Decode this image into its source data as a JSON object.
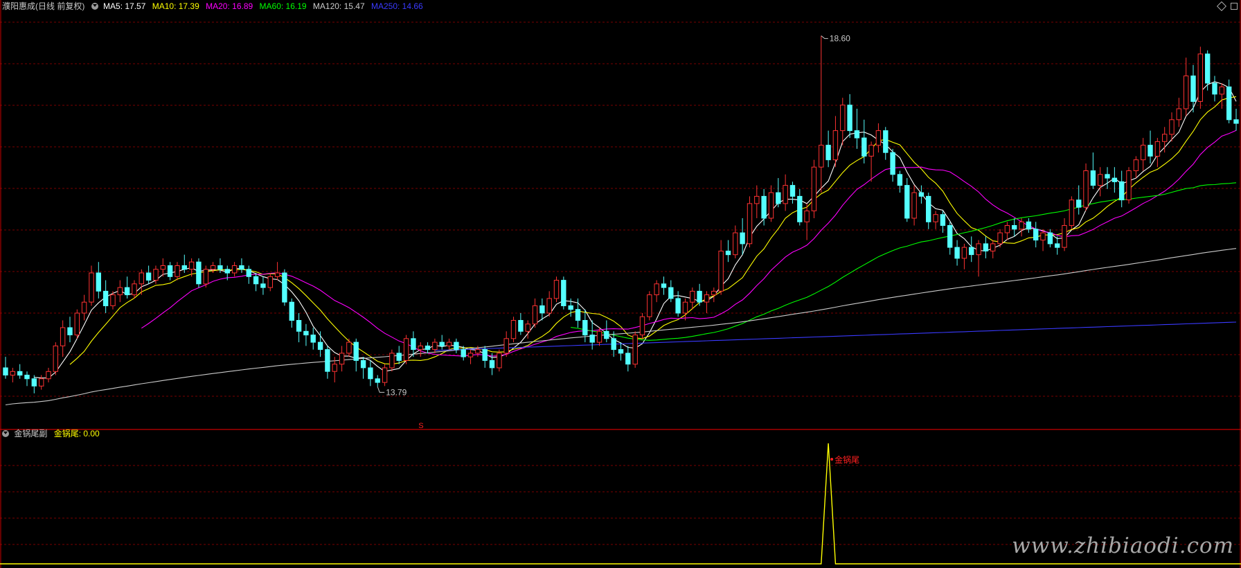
{
  "header": {
    "title": "濮阳惠成(日线 前复权)",
    "ma": [
      {
        "label": "MA5: 17.57",
        "color": "#ffffff"
      },
      {
        "label": "MA10: 17.39",
        "color": "#ffff00"
      },
      {
        "label": "MA20: 16.89",
        "color": "#ff00ff"
      },
      {
        "label": "MA60: 16.19",
        "color": "#00ff00"
      },
      {
        "label": "MA120: 15.47",
        "color": "#cccccc"
      },
      {
        "label": "MA250: 14.66",
        "color": "#3a3aff"
      }
    ]
  },
  "sub_header": {
    "indicator": "金锅尾副",
    "value_label": "金锅尾: 0.00"
  },
  "watermark": "www.zhibiaodi.com",
  "colors": {
    "up": "#ff3232",
    "down": "#54ffff",
    "grid": "#7a0000",
    "separator": "#c80000",
    "ma5": "#ffffff",
    "ma10": "#ffff00",
    "ma20": "#ff00ff",
    "ma60": "#00ff00",
    "ma120": "#cccccc",
    "ma250": "#3a3aff",
    "indicator": "#ffff00",
    "signal": "#ff2020"
  },
  "chart_data": [
    {
      "type": "candlestick",
      "title": "濮阳惠成(日线 前复权)",
      "ylim": [
        13.3,
        18.9
      ],
      "annotations": [
        {
          "text": "18.60",
          "kind": "period-high",
          "value": 18.6,
          "bar": 114
        },
        {
          "text": "13.79",
          "kind": "period-low",
          "value": 13.79,
          "bar": 52
        },
        {
          "text": "S",
          "kind": "signal",
          "bar": 58
        }
      ],
      "ohlc": [
        [
          14.05,
          14.2,
          13.9,
          13.95
        ],
        [
          13.95,
          14.05,
          13.85,
          14.0
        ],
        [
          14.0,
          14.1,
          13.9,
          13.95
        ],
        [
          13.95,
          14.0,
          13.8,
          13.9
        ],
        [
          13.9,
          13.95,
          13.7,
          13.8
        ],
        [
          13.8,
          13.95,
          13.75,
          13.9
        ],
        [
          13.9,
          14.05,
          13.85,
          14.0
        ],
        [
          14.0,
          14.4,
          13.95,
          14.35
        ],
        [
          14.35,
          14.7,
          14.2,
          14.6
        ],
        [
          14.6,
          14.75,
          14.4,
          14.5
        ],
        [
          14.5,
          14.85,
          14.45,
          14.8
        ],
        [
          14.8,
          15.05,
          14.7,
          14.95
        ],
        [
          14.95,
          15.45,
          14.9,
          15.35
        ],
        [
          15.35,
          15.5,
          15.0,
          15.1
        ],
        [
          15.1,
          15.25,
          14.8,
          14.9
        ],
        [
          14.9,
          15.1,
          14.85,
          15.05
        ],
        [
          15.05,
          15.25,
          14.95,
          15.15
        ],
        [
          15.15,
          15.3,
          15.0,
          15.05
        ],
        [
          15.05,
          15.25,
          15.0,
          15.2
        ],
        [
          15.2,
          15.4,
          15.05,
          15.35
        ],
        [
          15.35,
          15.45,
          15.2,
          15.25
        ],
        [
          15.25,
          15.45,
          15.2,
          15.4
        ],
        [
          15.4,
          15.55,
          15.3,
          15.45
        ],
        [
          15.45,
          15.5,
          15.25,
          15.3
        ],
        [
          15.3,
          15.5,
          15.25,
          15.45
        ],
        [
          15.45,
          15.6,
          15.35,
          15.4
        ],
        [
          15.4,
          15.55,
          15.3,
          15.5
        ],
        [
          15.5,
          15.55,
          15.15,
          15.2
        ],
        [
          15.2,
          15.45,
          15.15,
          15.4
        ],
        [
          15.4,
          15.5,
          15.35,
          15.45
        ],
        [
          15.45,
          15.55,
          15.35,
          15.4
        ],
        [
          15.4,
          15.45,
          15.25,
          15.35
        ],
        [
          15.35,
          15.5,
          15.3,
          15.45
        ],
        [
          15.45,
          15.55,
          15.35,
          15.4
        ],
        [
          15.4,
          15.45,
          15.2,
          15.3
        ],
        [
          15.3,
          15.35,
          15.1,
          15.2
        ],
        [
          15.2,
          15.3,
          15.05,
          15.15
        ],
        [
          15.15,
          15.35,
          15.1,
          15.3
        ],
        [
          15.3,
          15.5,
          15.25,
          15.35
        ],
        [
          15.35,
          15.4,
          14.9,
          14.95
        ],
        [
          14.95,
          15.0,
          14.6,
          14.7
        ],
        [
          14.7,
          14.8,
          14.4,
          14.55
        ],
        [
          14.55,
          14.65,
          14.35,
          14.5
        ],
        [
          14.5,
          14.6,
          14.3,
          14.4
        ],
        [
          14.4,
          14.55,
          14.2,
          14.3
        ],
        [
          14.3,
          14.35,
          13.9,
          14.0
        ],
        [
          14.0,
          14.2,
          13.85,
          14.1
        ],
        [
          14.1,
          14.35,
          14.0,
          14.25
        ],
        [
          14.25,
          14.45,
          14.2,
          14.4
        ],
        [
          14.4,
          14.45,
          14.0,
          14.15
        ],
        [
          14.15,
          14.2,
          13.9,
          14.05
        ],
        [
          14.05,
          14.15,
          13.8,
          13.9
        ],
        [
          13.9,
          13.95,
          13.79,
          13.85
        ],
        [
          13.85,
          14.1,
          13.8,
          14.05
        ],
        [
          14.05,
          14.3,
          14.0,
          14.25
        ],
        [
          14.25,
          14.35,
          14.1,
          14.15
        ],
        [
          14.15,
          14.5,
          14.1,
          14.45
        ],
        [
          14.45,
          14.55,
          14.2,
          14.3
        ],
        [
          14.3,
          14.4,
          14.2,
          14.35
        ],
        [
          14.35,
          14.4,
          14.25,
          14.3
        ],
        [
          14.3,
          14.45,
          14.25,
          14.4
        ],
        [
          14.4,
          14.5,
          14.3,
          14.35
        ],
        [
          14.35,
          14.45,
          14.3,
          14.4
        ],
        [
          14.4,
          14.45,
          14.25,
          14.3
        ],
        [
          14.3,
          14.35,
          14.15,
          14.2
        ],
        [
          14.2,
          14.3,
          14.1,
          14.25
        ],
        [
          14.25,
          14.35,
          14.2,
          14.3
        ],
        [
          14.3,
          14.35,
          14.05,
          14.15
        ],
        [
          14.15,
          14.25,
          13.95,
          14.05
        ],
        [
          14.05,
          14.3,
          14.0,
          14.25
        ],
        [
          14.25,
          14.55,
          14.2,
          14.45
        ],
        [
          14.45,
          14.75,
          14.4,
          14.7
        ],
        [
          14.7,
          14.8,
          14.5,
          14.55
        ],
        [
          14.55,
          14.7,
          14.45,
          14.65
        ],
        [
          14.65,
          15.0,
          14.6,
          14.9
        ],
        [
          14.9,
          15.0,
          14.7,
          14.8
        ],
        [
          14.8,
          15.1,
          14.75,
          15.0
        ],
        [
          15.0,
          15.3,
          14.95,
          15.25
        ],
        [
          15.25,
          15.3,
          14.85,
          14.9
        ],
        [
          14.9,
          15.0,
          14.75,
          14.85
        ],
        [
          14.85,
          15.0,
          14.6,
          14.7
        ],
        [
          14.7,
          14.85,
          14.4,
          14.5
        ],
        [
          14.5,
          14.7,
          14.3,
          14.4
        ],
        [
          14.4,
          14.6,
          14.35,
          14.55
        ],
        [
          14.55,
          14.7,
          14.4,
          14.45
        ],
        [
          14.45,
          14.55,
          14.2,
          14.3
        ],
        [
          14.3,
          14.4,
          14.15,
          14.25
        ],
        [
          14.25,
          14.35,
          14.0,
          14.1
        ],
        [
          14.1,
          14.55,
          14.05,
          14.5
        ],
        [
          14.5,
          14.8,
          14.45,
          14.75
        ],
        [
          14.75,
          15.1,
          14.7,
          15.05
        ],
        [
          15.05,
          15.25,
          14.95,
          15.2
        ],
        [
          15.2,
          15.3,
          15.05,
          15.15
        ],
        [
          15.15,
          15.25,
          14.95,
          15.0
        ],
        [
          15.0,
          15.1,
          14.75,
          14.8
        ],
        [
          14.8,
          15.0,
          14.7,
          14.95
        ],
        [
          14.95,
          15.15,
          14.85,
          15.1
        ],
        [
          15.1,
          15.2,
          14.9,
          14.95
        ],
        [
          14.95,
          15.1,
          14.8,
          15.05
        ],
        [
          15.05,
          15.15,
          14.95,
          15.1
        ],
        [
          15.1,
          15.8,
          15.05,
          15.65
        ],
        [
          15.65,
          15.8,
          15.5,
          15.6
        ],
        [
          15.6,
          16.0,
          15.55,
          15.9
        ],
        [
          15.9,
          16.1,
          15.6,
          15.75
        ],
        [
          15.75,
          16.4,
          15.7,
          16.3
        ],
        [
          16.3,
          16.55,
          16.1,
          16.4
        ],
        [
          16.4,
          16.5,
          16.0,
          16.1
        ],
        [
          16.1,
          16.55,
          16.05,
          16.45
        ],
        [
          16.45,
          16.65,
          16.25,
          16.3
        ],
        [
          16.3,
          16.7,
          16.2,
          16.55
        ],
        [
          16.55,
          16.6,
          16.3,
          16.4
        ],
        [
          16.4,
          16.5,
          16.0,
          16.05
        ],
        [
          16.05,
          16.3,
          15.8,
          16.2
        ],
        [
          16.2,
          16.9,
          16.1,
          16.8
        ],
        [
          16.8,
          18.6,
          16.45,
          17.1
        ],
        [
          17.1,
          17.3,
          16.8,
          16.9
        ],
        [
          16.9,
          17.5,
          16.8,
          17.3
        ],
        [
          17.3,
          17.75,
          17.1,
          17.65
        ],
        [
          17.65,
          17.8,
          17.2,
          17.3
        ],
        [
          17.3,
          17.6,
          17.05,
          17.2
        ],
        [
          17.2,
          17.45,
          16.85,
          16.95
        ],
        [
          16.95,
          17.15,
          16.6,
          17.1
        ],
        [
          17.1,
          17.4,
          17.0,
          17.3
        ],
        [
          17.3,
          17.35,
          16.9,
          17.0
        ],
        [
          17.0,
          17.05,
          16.6,
          16.7
        ],
        [
          16.7,
          16.75,
          16.45,
          16.55
        ],
        [
          16.55,
          16.65,
          16.05,
          16.1
        ],
        [
          16.1,
          16.55,
          16.0,
          16.45
        ],
        [
          16.45,
          16.55,
          16.3,
          16.4
        ],
        [
          16.4,
          16.45,
          15.95,
          16.05
        ],
        [
          16.05,
          16.2,
          15.95,
          16.15
        ],
        [
          16.15,
          16.2,
          15.9,
          16.0
        ],
        [
          16.0,
          16.05,
          15.6,
          15.7
        ],
        [
          15.7,
          15.8,
          15.45,
          15.55
        ],
        [
          15.55,
          15.75,
          15.4,
          15.7
        ],
        [
          15.7,
          15.85,
          15.5,
          15.6
        ],
        [
          15.6,
          15.8,
          15.3,
          15.75
        ],
        [
          15.75,
          15.85,
          15.55,
          15.65
        ],
        [
          15.65,
          15.8,
          15.55,
          15.75
        ],
        [
          15.75,
          15.95,
          15.7,
          15.9
        ],
        [
          15.9,
          16.05,
          15.8,
          16.0
        ],
        [
          16.0,
          16.1,
          15.85,
          15.95
        ],
        [
          15.95,
          16.1,
          15.85,
          16.05
        ],
        [
          16.05,
          16.1,
          15.9,
          15.95
        ],
        [
          15.95,
          16.05,
          15.7,
          15.8
        ],
        [
          15.8,
          15.95,
          15.65,
          15.9
        ],
        [
          15.9,
          15.95,
          15.7,
          15.75
        ],
        [
          15.75,
          15.85,
          15.6,
          15.7
        ],
        [
          15.7,
          16.1,
          15.65,
          16.0
        ],
        [
          16.0,
          16.4,
          15.95,
          16.35
        ],
        [
          16.35,
          16.55,
          16.15,
          16.25
        ],
        [
          16.25,
          16.85,
          16.2,
          16.75
        ],
        [
          16.75,
          17.0,
          16.5,
          16.55
        ],
        [
          16.55,
          16.8,
          16.4,
          16.7
        ],
        [
          16.7,
          16.8,
          16.5,
          16.65
        ],
        [
          16.65,
          16.8,
          16.45,
          16.6
        ],
        [
          16.6,
          16.75,
          16.25,
          16.35
        ],
        [
          16.35,
          16.8,
          16.3,
          16.75
        ],
        [
          16.75,
          16.95,
          16.65,
          16.9
        ],
        [
          16.9,
          17.2,
          16.75,
          17.1
        ],
        [
          17.1,
          17.3,
          16.85,
          16.95
        ],
        [
          16.95,
          17.2,
          16.8,
          17.15
        ],
        [
          17.15,
          17.35,
          17.0,
          17.25
        ],
        [
          17.25,
          17.55,
          17.15,
          17.45
        ],
        [
          17.45,
          17.75,
          17.35,
          17.6
        ],
        [
          17.6,
          18.3,
          17.5,
          18.05
        ],
        [
          18.05,
          18.2,
          17.55,
          17.7
        ],
        [
          17.7,
          18.45,
          17.6,
          18.35
        ],
        [
          18.35,
          18.4,
          17.85,
          17.95
        ],
        [
          17.95,
          18.05,
          17.7,
          17.8
        ],
        [
          17.8,
          17.95,
          17.6,
          17.9
        ],
        [
          17.9,
          18.0,
          17.4,
          17.45
        ],
        [
          17.45,
          17.6,
          17.3,
          17.4
        ]
      ],
      "ma_values": {
        "MA5": 17.57,
        "MA10": 17.39,
        "MA20": 16.89,
        "MA60": 16.19,
        "MA120": 15.47,
        "MA250": 14.66
      }
    },
    {
      "type": "line",
      "title": "金锅尾副",
      "series": [
        {
          "name": "金锅尾",
          "current_value": 0.0,
          "spike_bar": 115,
          "spike_value": 1.0
        }
      ],
      "annotations": [
        {
          "text": "金锅尾",
          "bar": 115
        }
      ]
    }
  ]
}
